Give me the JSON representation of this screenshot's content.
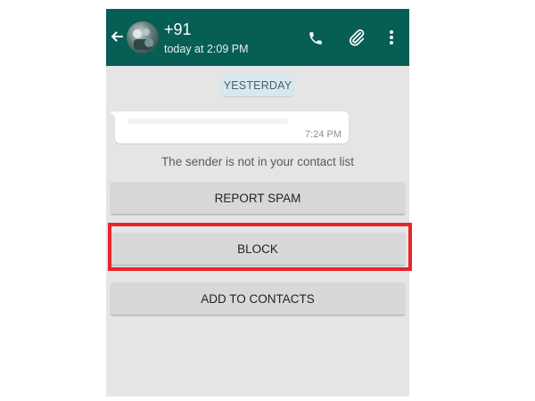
{
  "header": {
    "contact_name": "+91",
    "last_seen": "today at 2:09 PM",
    "back_icon": "arrow-left-icon",
    "icons": [
      "phone-icon",
      "paperclip-icon",
      "more-vert-icon"
    ],
    "color": "#075e54"
  },
  "chat": {
    "date_chip": "YESTERDAY",
    "message": {
      "time": "7:24 PM"
    },
    "notice": "The sender is not in your contact list"
  },
  "actions": {
    "report_spam": "REPORT SPAM",
    "block": "BLOCK",
    "add_to_contacts": "ADD TO CONTACTS"
  },
  "annotation": {
    "highlight_color": "#e8242b"
  }
}
